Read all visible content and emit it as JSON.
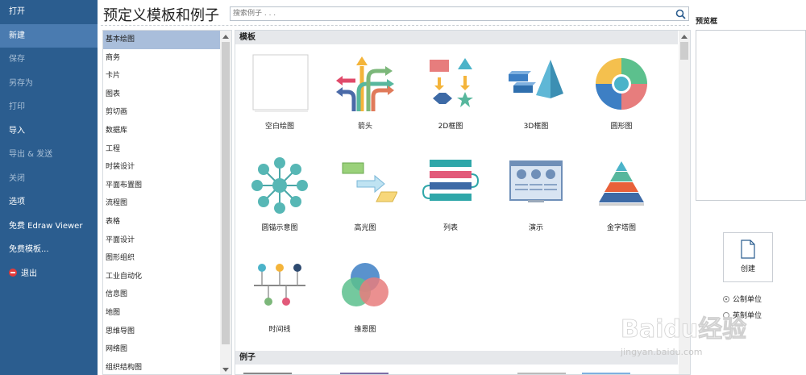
{
  "menu": {
    "items": [
      {
        "label": "打开"
      },
      {
        "label": "新建"
      },
      {
        "label": "保存"
      },
      {
        "label": "另存为"
      },
      {
        "label": "打印"
      },
      {
        "label": "导入"
      },
      {
        "label": "导出 & 发送"
      },
      {
        "label": "关闭"
      },
      {
        "label": "选项"
      },
      {
        "label": "免费 Edraw Viewer"
      },
      {
        "label": "免费模板..."
      },
      {
        "label": "退出"
      }
    ]
  },
  "header": {
    "title": "预定义模板和例子",
    "search_placeholder": "搜索例子 . . ."
  },
  "categories": [
    "基本绘图",
    "商务",
    "卡片",
    "图表",
    "剪切画",
    "数据库",
    "工程",
    "时装设计",
    "平面布置图",
    "流程图",
    "表格",
    "平面设计",
    "图形组织",
    "工业自动化",
    "信息图",
    "地图",
    "思维导图",
    "网络图",
    "组织结构图"
  ],
  "templates": {
    "section_label": "模板",
    "examples_label": "例子",
    "tiles": [
      {
        "label": "空白绘图",
        "icon": "blank-page-icon"
      },
      {
        "label": "箭头",
        "icon": "arrows-icon"
      },
      {
        "label": "2D框图",
        "icon": "2d-block-icon"
      },
      {
        "label": "3D框图",
        "icon": "3d-block-icon"
      },
      {
        "label": "圆形图",
        "icon": "circle-chart-icon"
      },
      {
        "label": "圆锚示意图",
        "icon": "circle-spoke-icon"
      },
      {
        "label": "高光图",
        "icon": "highlight-icon"
      },
      {
        "label": "列表",
        "icon": "list-icon"
      },
      {
        "label": "演示",
        "icon": "presentation-icon"
      },
      {
        "label": "金字塔图",
        "icon": "pyramid-icon"
      },
      {
        "label": "时间线",
        "icon": "timeline-icon"
      },
      {
        "label": "维恩图",
        "icon": "venn-icon"
      }
    ]
  },
  "preview": {
    "title": "预览框"
  },
  "create": {
    "label": "创建"
  },
  "units": {
    "metric": "公制单位",
    "imperial": "英制单位"
  },
  "watermark": {
    "brand": "Baidu经验",
    "url": "jingyan.baidu.com"
  }
}
